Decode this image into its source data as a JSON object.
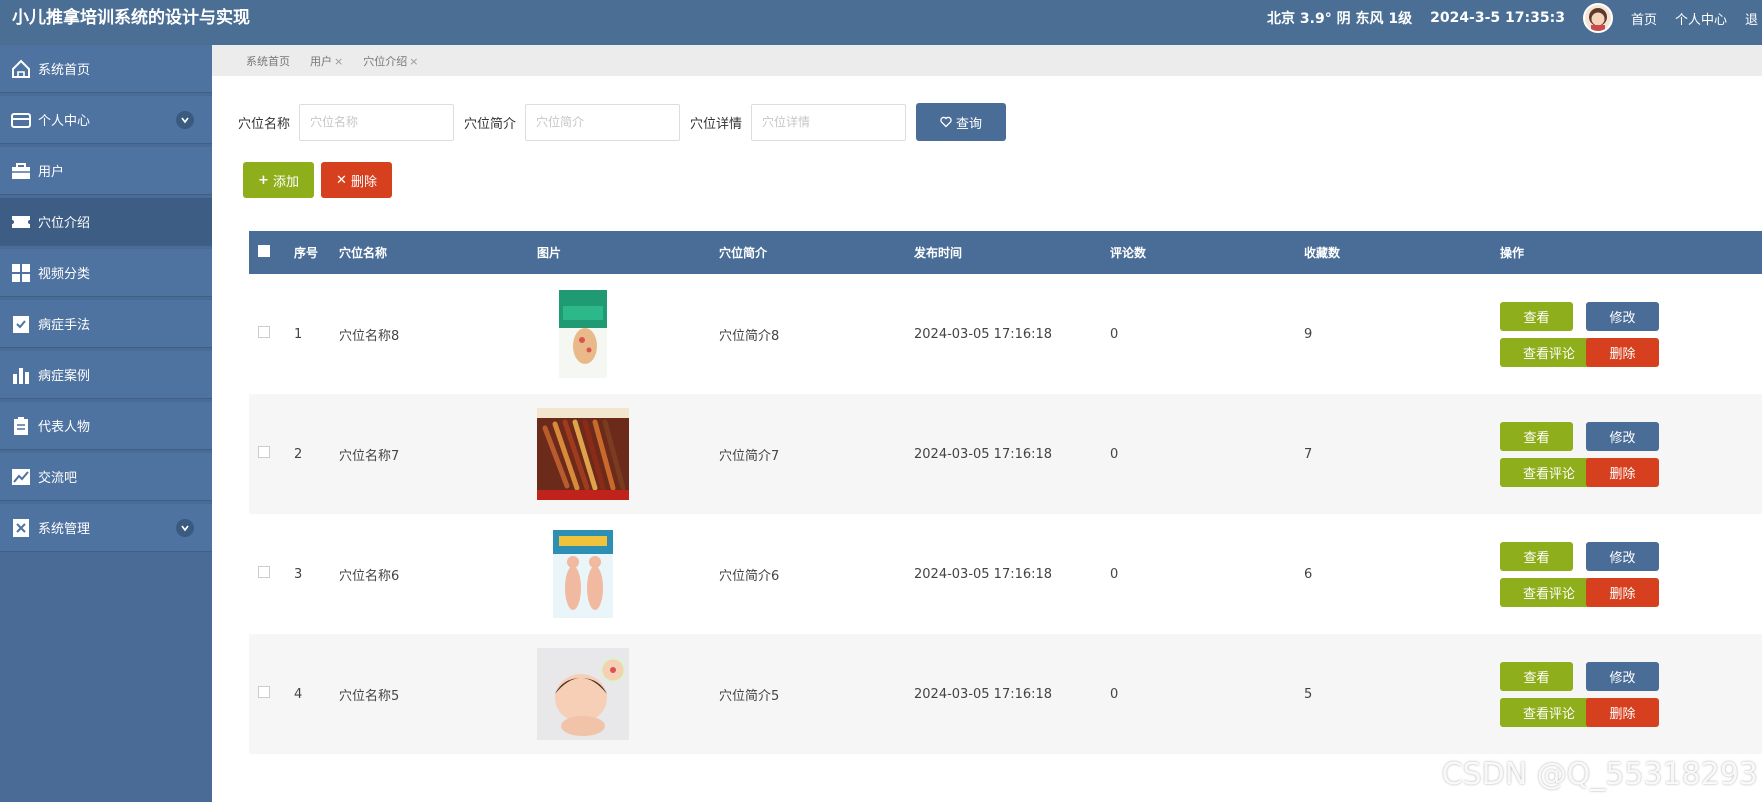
{
  "header": {
    "app_title": "小儿推拿培训系统的设计与实现",
    "weather": "北京 3.9° 阴 东风 1级",
    "datetime": "2024-3-5 17:35:3",
    "home_link": "首页",
    "profile_link": "个人中心",
    "logout_link": "退"
  },
  "sidebar": {
    "items": [
      {
        "label": "系统首页",
        "icon": "home-icon"
      },
      {
        "label": "个人中心",
        "icon": "wallet-icon"
      },
      {
        "label": "用户",
        "icon": "briefcase-icon"
      },
      {
        "label": "穴位介绍",
        "icon": "ticket-icon"
      },
      {
        "label": "视频分类",
        "icon": "grid-icon"
      },
      {
        "label": "病症手法",
        "icon": "check-clipboard-icon"
      },
      {
        "label": "病症案例",
        "icon": "bar-chart-icon"
      },
      {
        "label": "代表人物",
        "icon": "clipboard-icon"
      },
      {
        "label": "交流吧",
        "icon": "trend-icon"
      },
      {
        "label": "系统管理",
        "icon": "x-doc-icon"
      }
    ]
  },
  "breadcrumb": {
    "items": [
      {
        "label": "系统首页",
        "closable": false
      },
      {
        "label": "用户",
        "closable": true
      },
      {
        "label": "穴位介绍",
        "closable": true
      }
    ]
  },
  "search": {
    "name_label": "穴位名称",
    "name_placeholder": "穴位名称",
    "intro_label": "穴位简介",
    "intro_placeholder": "穴位简介",
    "detail_label": "穴位详情",
    "detail_placeholder": "穴位详情",
    "query_button": "查询"
  },
  "toolbar": {
    "add_label": "添加",
    "delete_label": "删除"
  },
  "table": {
    "headers": {
      "index": "序号",
      "name": "穴位名称",
      "image": "图片",
      "intro": "穴位简介",
      "time": "发布时间",
      "comments": "评论数",
      "favorites": "收藏数",
      "ops": "操作"
    },
    "rows": [
      {
        "index": "1",
        "name": "穴位名称8",
        "intro": "穴位简介8",
        "time": "2024-03-05 17:16:18",
        "comments": "0",
        "favorites": "9"
      },
      {
        "index": "2",
        "name": "穴位名称7",
        "intro": "穴位简介7",
        "time": "2024-03-05 17:16:18",
        "comments": "0",
        "favorites": "7"
      },
      {
        "index": "3",
        "name": "穴位名称6",
        "intro": "穴位简介6",
        "time": "2024-03-05 17:16:18",
        "comments": "0",
        "favorites": "6"
      },
      {
        "index": "4",
        "name": "穴位名称5",
        "intro": "穴位简介5",
        "time": "2024-03-05 17:16:18",
        "comments": "0",
        "favorites": "5"
      }
    ],
    "row_actions": {
      "view": "查看",
      "edit": "修改",
      "view_comments": "查看评论",
      "delete": "删除"
    }
  },
  "watermark": "CSDN @Q_55318293"
}
